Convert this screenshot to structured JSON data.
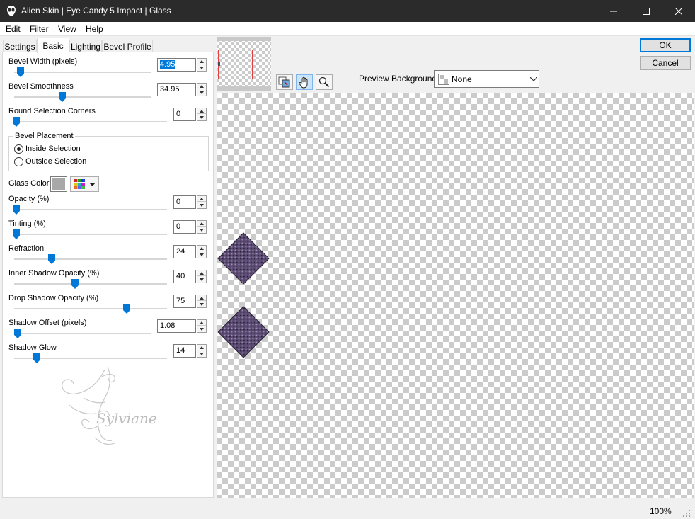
{
  "window": {
    "title": "Alien Skin | Eye Candy 5 Impact | Glass",
    "controls": {
      "minimize": "minimize-icon",
      "maximize": "maximize-icon",
      "close": "close-icon"
    }
  },
  "menu": [
    "Edit",
    "Filter",
    "View",
    "Help"
  ],
  "tabs": [
    "Settings",
    "Basic",
    "Lighting",
    "Bevel Profile"
  ],
  "active_tab": "Basic",
  "params": {
    "bevel_width": {
      "label": "Bevel Width (pixels)",
      "value": "4.95",
      "level": 0.03
    },
    "bevel_smoothness": {
      "label": "Bevel Smoothness",
      "value": "34.95",
      "level": 0.35
    },
    "round_corners": {
      "label": "Round Selection Corners",
      "value": "0",
      "level": 0.0
    },
    "opacity": {
      "label": "Opacity (%)",
      "value": "0",
      "level": 0.0
    },
    "tinting": {
      "label": "Tinting (%)",
      "value": "0",
      "level": 0.0
    },
    "refraction": {
      "label": "Refraction",
      "value": "24",
      "level": 0.24
    },
    "inner_shadow": {
      "label": "Inner Shadow Opacity (%)",
      "value": "40",
      "level": 0.4
    },
    "drop_shadow": {
      "label": "Drop Shadow Opacity (%)",
      "value": "75",
      "level": 0.75
    },
    "shadow_offset": {
      "label": "Shadow Offset (pixels)",
      "value": "1.08",
      "level": 0.01
    },
    "shadow_glow": {
      "label": "Shadow Glow",
      "value": "14",
      "level": 0.14
    }
  },
  "placement": {
    "legend": "Bevel Placement",
    "options": [
      "Inside Selection",
      "Outside Selection"
    ],
    "selected": "Inside Selection"
  },
  "glass_color": {
    "label": "Glass Color",
    "swatch": "#a8a8a8"
  },
  "preview_background": {
    "label": "Preview Background:",
    "value": "None"
  },
  "buttons": {
    "ok": "OK",
    "cancel": "Cancel"
  },
  "status": {
    "zoom": "100%"
  },
  "watermark_text": "Sylviane"
}
